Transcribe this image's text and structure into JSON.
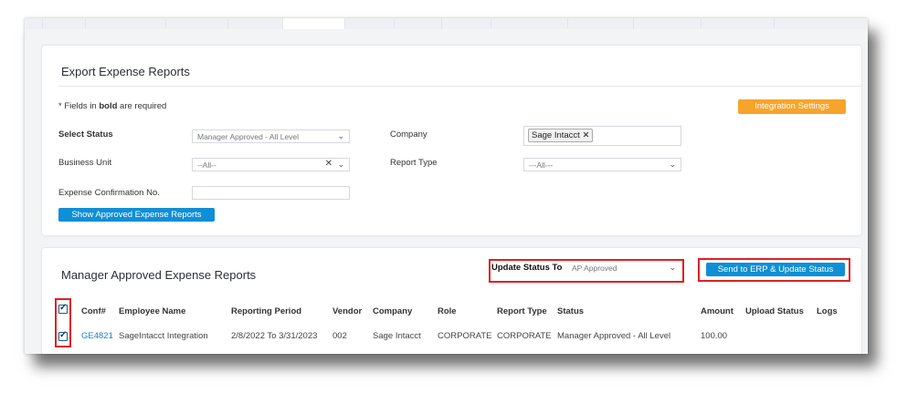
{
  "export_panel": {
    "title": "Export Expense Reports",
    "required_note_prefix": "* Fields in ",
    "required_note_bold": "bold",
    "required_note_suffix": " are required",
    "integration_settings_label": "Integration Settings",
    "select_status_label": "Select Status",
    "select_status_value": "Manager Approved - All Level",
    "company_label": "Company",
    "company_tag": "Sage Intacct",
    "business_unit_label": "Business Unit",
    "business_unit_value": "--All--",
    "report_type_label": "Report Type",
    "report_type_value": "---All---",
    "expense_conf_label": "Expense Confirmation No.",
    "expense_conf_value": "",
    "show_button_label": "Show Approved Expense Reports"
  },
  "reports_panel": {
    "title": "Manager Approved Expense Reports",
    "update_status_label": "Update Status To",
    "update_status_value": "AP Approved",
    "send_button_label": "Send to ERP & Update Status",
    "columns": [
      "Conf#",
      "Employee Name",
      "Reporting Period",
      "Vendor",
      "Company",
      "Role",
      "Report Type",
      "Status",
      "Amount",
      "Upload Status",
      "Logs"
    ],
    "rows": [
      {
        "conf": "GE4821",
        "employee": "SageIntacct Integration",
        "period": "2/8/2022 To 3/31/2023",
        "vendor": "002",
        "company": "Sage Intacct",
        "role": "CORPORATE",
        "report_type": "CORPORATE",
        "status": "Manager Approved - All Level",
        "amount": "100.00",
        "upload_status": "",
        "logs": ""
      }
    ]
  },
  "colors": {
    "primary_button": "#0f8fd6",
    "integration_button": "#f7a42b",
    "highlight_border": "#e02020",
    "link": "#1a7fd0"
  }
}
